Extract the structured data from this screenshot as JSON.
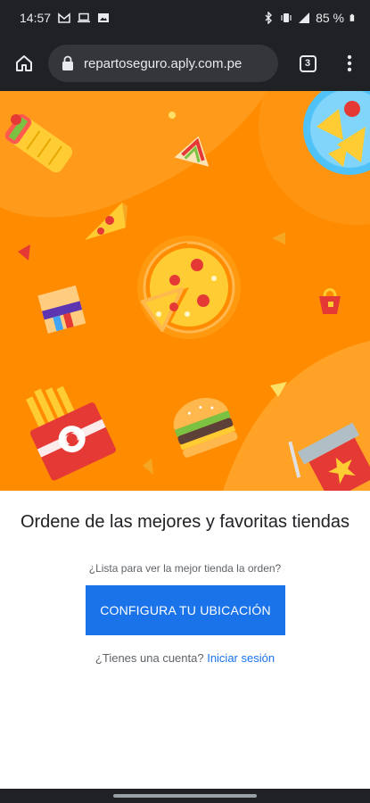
{
  "status_bar": {
    "time": "14:57",
    "left_icons": [
      "gmail-icon",
      "laptop-icon",
      "image-icon"
    ],
    "right_icons": [
      "bluetooth-icon",
      "vibrate-icon",
      "signal-icon",
      "battery-icon"
    ],
    "battery": "85 %"
  },
  "browser": {
    "url": "repartoseguro.aply.com.pe",
    "tab_count": "3",
    "icons": {
      "home": "home-icon",
      "lock": "lock-icon",
      "menu": "more-vert-icon"
    }
  },
  "hero": {
    "background": "#ff8c00",
    "illustrations": [
      "burrito-icon",
      "sandwich-icon",
      "pizza-slice-icon",
      "pizza-icon",
      "fries-icon",
      "burger-icon",
      "drink-icon",
      "nachos-icon",
      "noodles-icon",
      "cake-icon"
    ]
  },
  "main": {
    "headline": "Ordene de las mejores y favoritas tiendas",
    "subline": "¿Lista para ver la mejor tienda la orden?",
    "cta_label": "CONFIGURA TU UBICACIÓN",
    "login_prompt": "¿Tienes una cuenta?",
    "login_link": "Iniciar sesión"
  },
  "colors": {
    "accent": "#1a73e8",
    "hero_orange": "#ff8c00",
    "chrome_dark": "#202124"
  }
}
